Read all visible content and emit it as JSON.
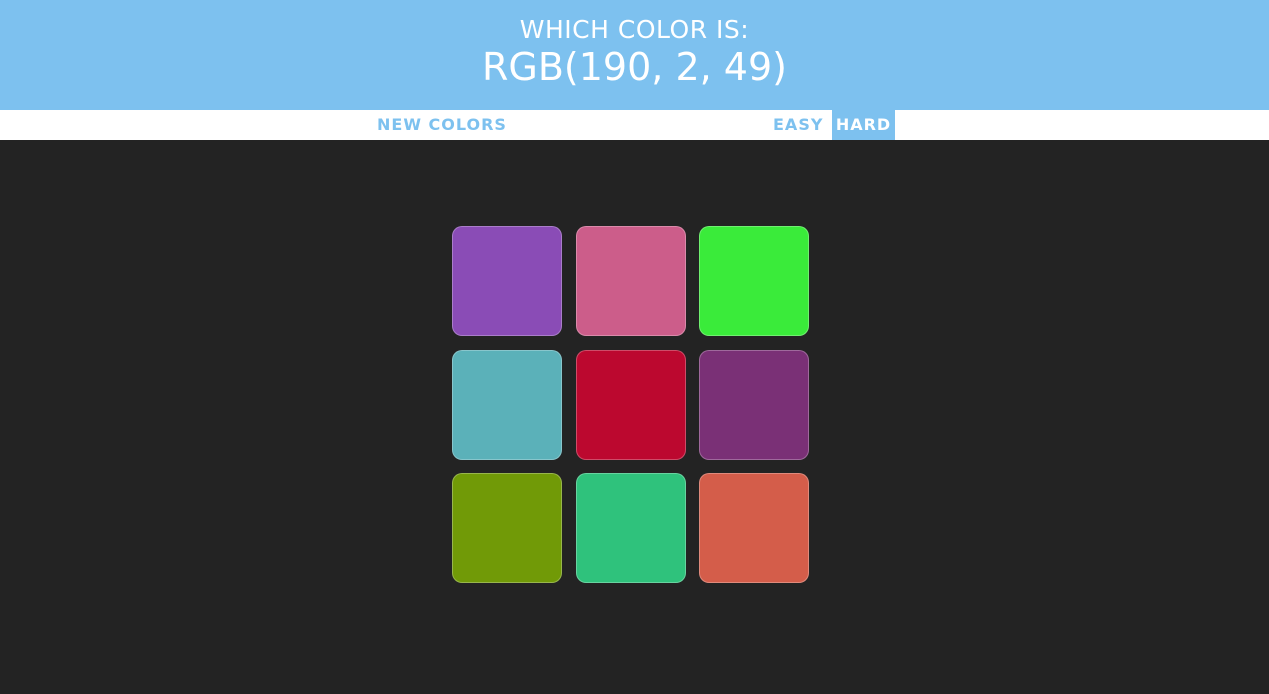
{
  "header": {
    "question": "WHICH COLOR IS:",
    "target": "RGB(190, 2, 49)"
  },
  "controls": {
    "new_colors": "NEW COLORS",
    "easy": "EASY",
    "hard": "HARD",
    "selected_mode": "HARD"
  },
  "colors": {
    "header_bg": "#7dc1ef",
    "page_bg": "#232323"
  },
  "squares": [
    "#8a4cb6",
    "#cc5d8a",
    "#3aeb3a",
    "#5bb1b9",
    "#bc082f",
    "#7a3076",
    "#719a07",
    "#2fc27c",
    "#d45d4a"
  ]
}
